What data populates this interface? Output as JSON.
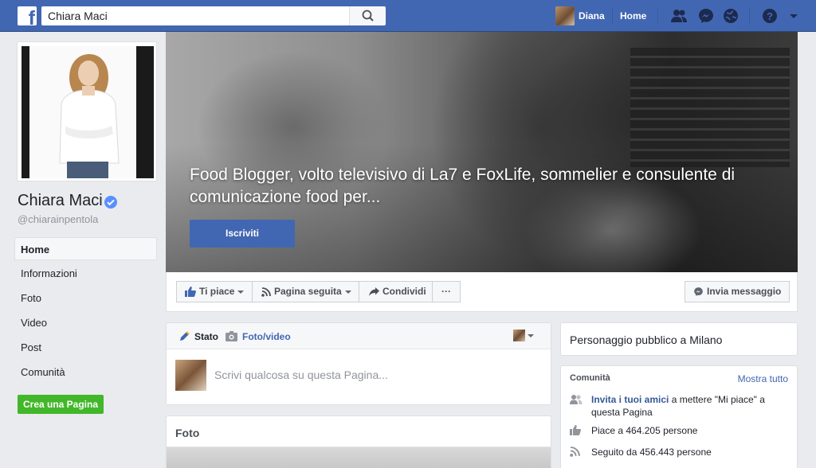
{
  "topbar": {
    "search_value": "Chiara Maci",
    "user_name": "Diana",
    "home_label": "Home"
  },
  "profile": {
    "name": "Chiara Maci",
    "handle": "@chiarainpentola",
    "verified": true
  },
  "left_nav": {
    "items": [
      {
        "label": "Home",
        "active": true
      },
      {
        "label": "Informazioni"
      },
      {
        "label": "Foto"
      },
      {
        "label": "Video"
      },
      {
        "label": "Post"
      },
      {
        "label": "Comunità"
      }
    ],
    "create_page_label": "Crea una Pagina"
  },
  "cover": {
    "title": "Food Blogger, volto televisivo di La7 e FoxLife, sommelier e consulente di comunicazione food per...",
    "subscribe_label": "Iscriviti"
  },
  "actions": {
    "like_label": "Ti piace",
    "follow_label": "Pagina seguita",
    "share_label": "Condividi",
    "more_label": "···",
    "message_label": "Invia messaggio"
  },
  "composer": {
    "tab_status": "Stato",
    "tab_photo": "Foto/video",
    "placeholder": "Scrivi qualcosa su questa Pagina..."
  },
  "photos": {
    "title": "Foto"
  },
  "info": {
    "text": "Personaggio pubblico a Milano"
  },
  "community": {
    "title": "Comunità",
    "see_all": "Mostra tutto",
    "invite_link": "Invita i tuoi amici",
    "invite_rest": " a mettere \"Mi piace\" a questa Pagina",
    "likes": "Piace a 464.205 persone",
    "follows": "Seguito da 456.443 persone"
  },
  "colors": {
    "brand": "#4267b2",
    "green": "#42b72a",
    "verified": "#5890ff"
  }
}
